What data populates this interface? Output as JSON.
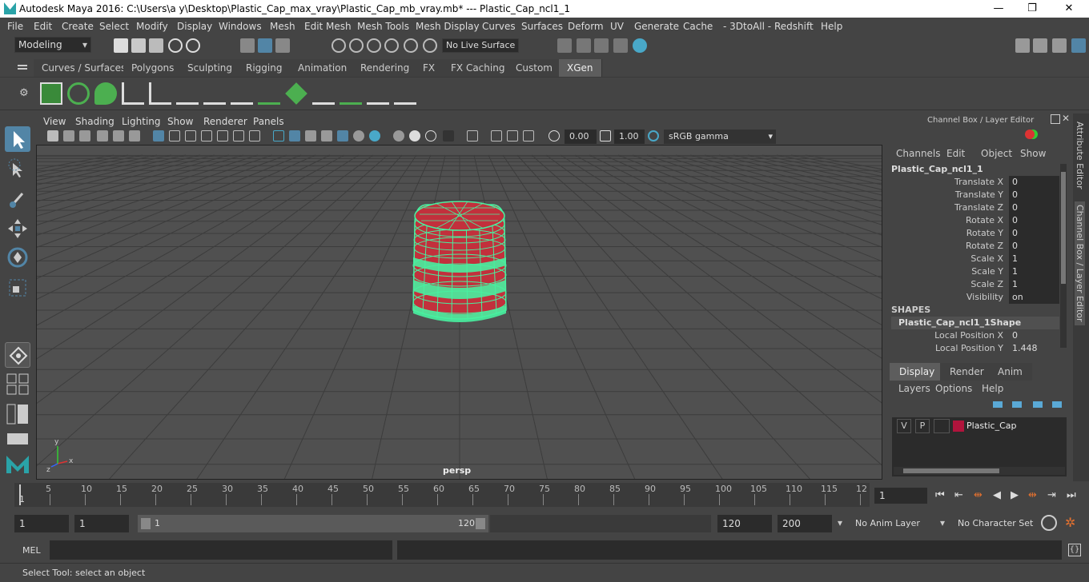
{
  "title_bar": {
    "text": "Autodesk Maya 2016: C:\\Users\\a y\\Desktop\\Plastic_Cap_max_vray\\Plastic_Cap_mb_vray.mb*   ---   Plastic_Cap_ncl1_1",
    "minimize": "—",
    "maximize": "❐",
    "close": "✕"
  },
  "menu": [
    "File",
    "Edit",
    "Create",
    "Select",
    "Modify",
    "Display",
    "Windows",
    "Mesh",
    "Edit Mesh",
    "Mesh Tools",
    "Mesh Display",
    "Curves",
    "Surfaces",
    "Deform",
    "UV",
    "Generate",
    "Cache",
    "- 3DtoAll -",
    "Redshift",
    "Help"
  ],
  "status_line": {
    "mode": "Modeling",
    "live_surface": "No Live Surface"
  },
  "shelf_tabs": [
    "Curves / Surfaces",
    "Polygons",
    "Sculpting",
    "Rigging",
    "Animation",
    "Rendering",
    "FX",
    "FX Caching",
    "Custom",
    "XGen"
  ],
  "active_shelf_tab": "XGen",
  "viewport": {
    "menu": [
      "View",
      "Shading",
      "Lighting",
      "Show",
      "Renderer",
      "Panels"
    ],
    "exposure": "0.00",
    "gamma": "1.00",
    "color_space": "sRGB gamma",
    "camera_label": "persp"
  },
  "channel_box": {
    "header": "Channel Box / Layer Editor",
    "menu": [
      "Channels",
      "Edit",
      "Object",
      "Show"
    ],
    "object_name": "Plastic_Cap_ncl1_1",
    "attributes": [
      {
        "label": "Translate X",
        "value": "0"
      },
      {
        "label": "Translate Y",
        "value": "0"
      },
      {
        "label": "Translate Z",
        "value": "0"
      },
      {
        "label": "Rotate X",
        "value": "0"
      },
      {
        "label": "Rotate Y",
        "value": "0"
      },
      {
        "label": "Rotate Z",
        "value": "0"
      },
      {
        "label": "Scale X",
        "value": "1"
      },
      {
        "label": "Scale Y",
        "value": "1"
      },
      {
        "label": "Scale Z",
        "value": "1"
      },
      {
        "label": "Visibility",
        "value": "on"
      }
    ],
    "shapes_heading": "SHAPES",
    "shape_name": "Plastic_Cap_ncl1_1Shape",
    "shape_attributes": [
      {
        "label": "Local Position X",
        "value": "0"
      },
      {
        "label": "Local Position Y",
        "value": "1.448"
      }
    ]
  },
  "side_tabs": [
    "Attribute Editor",
    "Channel Box / Layer Editor"
  ],
  "layer_editor": {
    "tabs": [
      "Display",
      "Render",
      "Anim"
    ],
    "active_tab": "Display",
    "menu": [
      "Layers",
      "Options",
      "Help"
    ],
    "layers": [
      {
        "v": "V",
        "p": "P",
        "name": "Plastic_Cap",
        "color": "#b0143c"
      }
    ]
  },
  "timeline": {
    "ticks": [
      "5",
      "10",
      "15",
      "20",
      "25",
      "30",
      "35",
      "40",
      "45",
      "50",
      "55",
      "60",
      "65",
      "70",
      "75",
      "80",
      "85",
      "90",
      "95",
      "100",
      "105",
      "110",
      "115",
      "12"
    ],
    "start_marker": "1",
    "current_frame": "1"
  },
  "range": {
    "start": "1",
    "playback_start": "1",
    "slider_start": "1",
    "slider_end": "120",
    "playback_end": "120",
    "end": "200",
    "anim_layer": "No Anim Layer",
    "character_set": "No Character Set"
  },
  "command_line": {
    "label": "MEL"
  },
  "help_line": "Select Tool: select an object",
  "colors": {
    "accent": "#5285a6",
    "wire": "#48f0a0",
    "mesh_fill": "#c2303c"
  }
}
